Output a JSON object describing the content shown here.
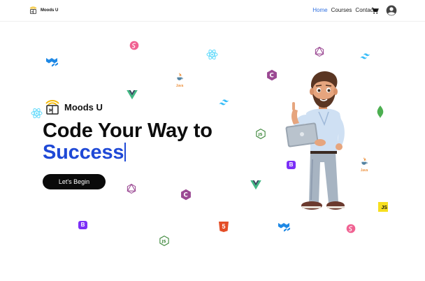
{
  "brand": {
    "name": "Moods U",
    "hero_name": "Moods U"
  },
  "nav": {
    "home": "Home",
    "courses": "Courses",
    "contact": "Contact"
  },
  "hero": {
    "line1": "Code Your Way to",
    "line2": "Success",
    "cta": "Let's Begin"
  },
  "tech_labels": {
    "java": "Java",
    "js": "JS",
    "html5": "5",
    "bootstrap": "B",
    "c": "C"
  },
  "colors": {
    "accent_blue": "#1f49d6",
    "nav_active": "#2f6fe0",
    "react": "#61dafb",
    "mui": "#1e88e5",
    "vue": "#41b883",
    "vue_dark": "#35495e",
    "tailwind": "#38bdf8",
    "graphql": "#e10098",
    "sass": "#f06292",
    "bootstrap": "#7b2ff7",
    "node": "#3c873a",
    "html5": "#e44d26",
    "js": "#f7df1e",
    "mongodb": "#4caf50",
    "c_lang": "#9b4993"
  },
  "icons": [
    "brand-logo-icon",
    "cart-icon",
    "account-icon",
    "react-icon",
    "material-ui-icon",
    "sass-icon",
    "java-icon",
    "vue-icon",
    "c-lang-icon",
    "tailwind-icon",
    "graphql-icon",
    "nodejs-icon",
    "bootstrap-icon",
    "html5-icon",
    "mongodb-icon",
    "javascript-icon"
  ]
}
